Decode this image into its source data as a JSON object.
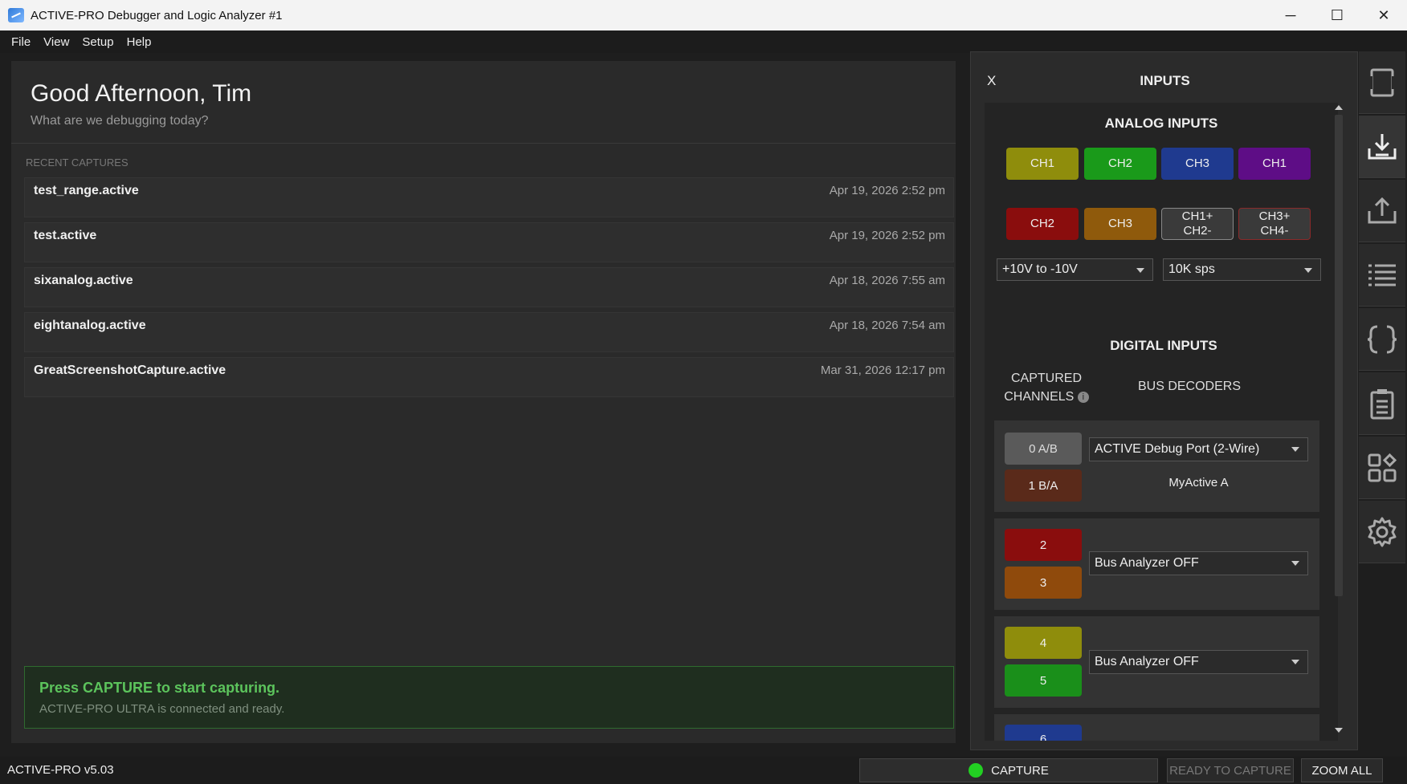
{
  "window": {
    "title": "ACTIVE-PRO Debugger and Logic Analyzer #1",
    "minimize": "─",
    "maximize": "☐",
    "close": "✕"
  },
  "menu": [
    "File",
    "View",
    "Setup",
    "Help"
  ],
  "home": {
    "greeting": "Good Afternoon, Tim",
    "subtitle": "What are we debugging today?",
    "recent_label": "RECENT CAPTURES",
    "captures": [
      {
        "name": "test_range.active",
        "date": "Apr 19, 2026  2:52 pm"
      },
      {
        "name": "test.active",
        "date": "Apr 19, 2026  2:52 pm"
      },
      {
        "name": "sixanalog.active",
        "date": "Apr 18, 2026  7:55 am"
      },
      {
        "name": "eightanalog.active",
        "date": "Apr 18, 2026  7:54 am"
      },
      {
        "name": "GreatScreenshotCapture.active",
        "date": "Mar 31, 2026  12:17 pm"
      }
    ],
    "status_title": "Press CAPTURE to start capturing.",
    "status_sub": "ACTIVE-PRO ULTRA is connected and ready."
  },
  "inputs": {
    "close": "X",
    "title": "INPUTS",
    "analog_title": "ANALOG INPUTS",
    "analog_channels": [
      {
        "label": "CH1",
        "color": "#8f8d0c"
      },
      {
        "label": "CH2",
        "color": "#1a9a1a"
      },
      {
        "label": "CH3",
        "color": "#1f3a8f"
      },
      {
        "label": "CH1",
        "color": "#5e0d86"
      },
      {
        "label": "CH2",
        "color": "#8a0d0d"
      },
      {
        "label": "CH3",
        "color": "#8f5a0c"
      },
      {
        "label": "CH1+\nCH2-",
        "color": "#3a3a3a"
      },
      {
        "label": "CH3+\nCH4-",
        "color": "#3a3a3a"
      }
    ],
    "range": "+10V to -10V",
    "rate": "10K sps",
    "digital_title": "DIGITAL INPUTS",
    "captured_label_1": "CAPTURED",
    "captured_label_2": "CHANNELS",
    "info": "i",
    "bus_label": "BUS DECODERS",
    "groups": [
      {
        "ch_a": "0 A/B",
        "ch_a_color": "#5a5a5a",
        "ch_b": "1 B/A",
        "ch_b_color": "#5a2a1a",
        "decoder": "ACTIVE Debug Port (2-Wire)",
        "extra": "MyActive A"
      },
      {
        "ch_a": "2",
        "ch_a_color": "#8a0d0d",
        "ch_b": "3",
        "ch_b_color": "#8f4a0c",
        "decoder": "Bus Analyzer OFF",
        "extra": ""
      },
      {
        "ch_a": "4",
        "ch_a_color": "#8f8d0c",
        "ch_b": "5",
        "ch_b_color": "#1a8f1a",
        "decoder": "Bus Analyzer OFF",
        "extra": ""
      },
      {
        "ch_a": "6",
        "ch_a_color": "#1f3a8f",
        "ch_b": "",
        "ch_b_color": "#333",
        "decoder": "",
        "extra": ""
      }
    ]
  },
  "sidebar": [
    "frame-icon",
    "import-icon",
    "export-icon",
    "list-icon",
    "braces-icon",
    "notes-icon",
    "apps-icon",
    "settings-icon"
  ],
  "bottom": {
    "version": "ACTIVE-PRO v5.03",
    "capture": "CAPTURE",
    "ready": "READY TO CAPTURE",
    "zoom": "ZOOM ALL"
  }
}
